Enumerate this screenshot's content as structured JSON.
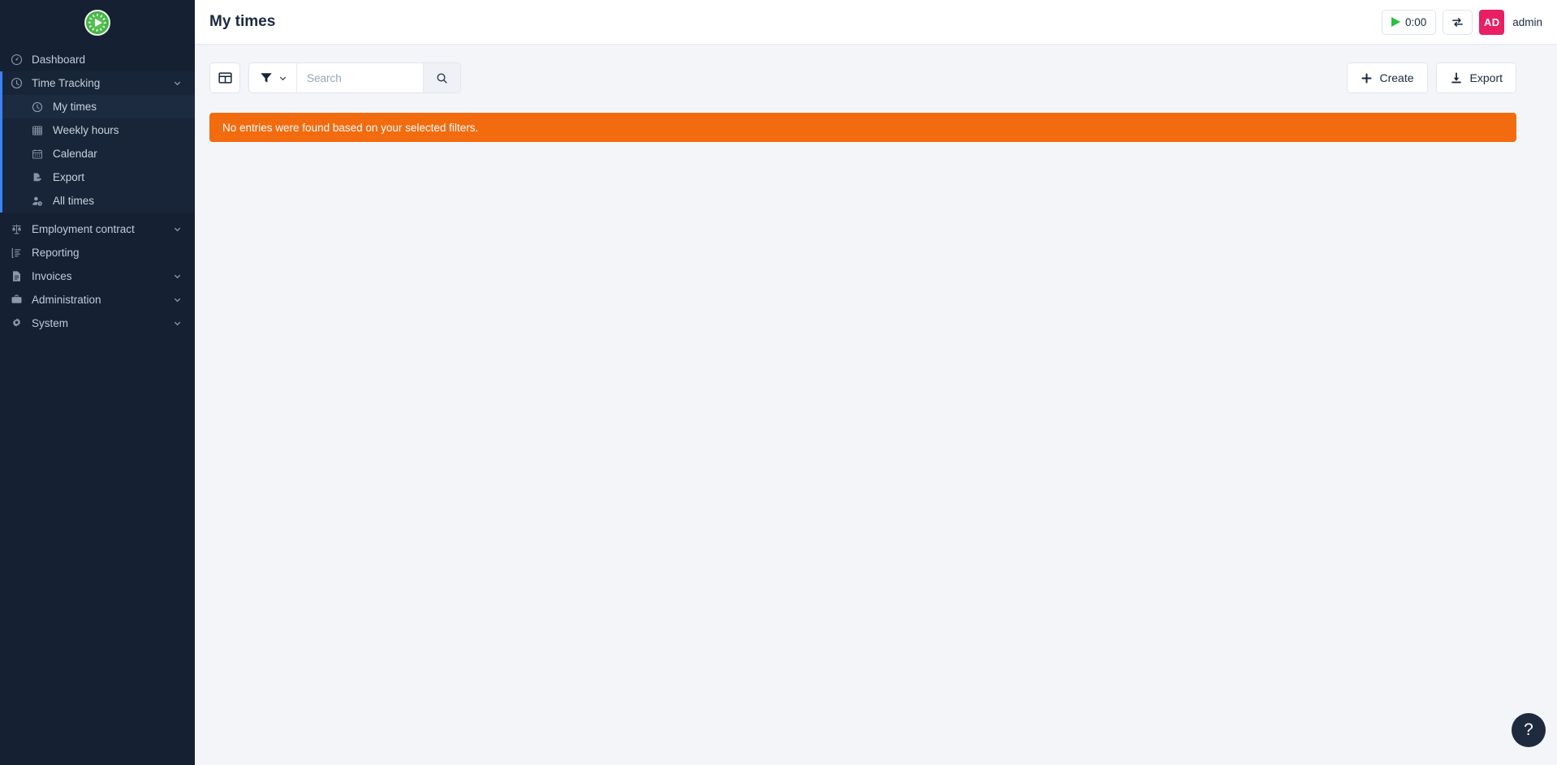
{
  "app": {
    "logo_icon": "clock-play-logo-icon",
    "accent_color": "#3b82f6",
    "sidebar_bg": "#152033",
    "alert_color": "#f26b0f",
    "avatar_color": "#e91e63",
    "logo_green": "#46b545"
  },
  "sidebar": {
    "items": [
      {
        "label": "Dashboard",
        "icon": "gauge-icon",
        "has_caret": false
      },
      {
        "label": "Time Tracking",
        "icon": "clock-icon",
        "has_caret": true
      },
      {
        "label": "Employment contract",
        "icon": "scales-icon",
        "has_caret": true
      },
      {
        "label": "Reporting",
        "icon": "report-chart-icon",
        "has_caret": false
      },
      {
        "label": "Invoices",
        "icon": "invoice-document-icon",
        "has_caret": true
      },
      {
        "label": "Administration",
        "icon": "toolbox-icon",
        "has_caret": true
      },
      {
        "label": "System",
        "icon": "gear-icon",
        "has_caret": true
      }
    ],
    "time_tracking_children": [
      {
        "label": "My times",
        "icon": "clock-icon",
        "active": true
      },
      {
        "label": "Weekly hours",
        "icon": "grid-table-icon",
        "active": false
      },
      {
        "label": "Calendar",
        "icon": "calendar-icon",
        "active": false
      },
      {
        "label": "Export",
        "icon": "file-export-icon",
        "active": false
      },
      {
        "label": "All times",
        "icon": "user-clock-icon",
        "active": false
      }
    ]
  },
  "header": {
    "title": "My times",
    "timer_label": "0:00",
    "timer_icon": "play-icon",
    "sync_icon": "sync-arrows-icon",
    "avatar_initials": "AD",
    "username": "admin"
  },
  "toolbar": {
    "columns_icon": "table-columns-icon",
    "filter_icon": "funnel-filter-icon",
    "filter_caret_icon": "chevron-down-icon",
    "search_placeholder": "Search",
    "search_value": "",
    "search_button_icon": "search-icon",
    "create_label": "Create",
    "create_icon": "plus-icon",
    "export_label": "Export",
    "export_icon": "download-icon"
  },
  "main": {
    "alert_message": "No entries were found based on your selected filters."
  },
  "help": {
    "icon": "question-mark-icon",
    "label": "?"
  }
}
